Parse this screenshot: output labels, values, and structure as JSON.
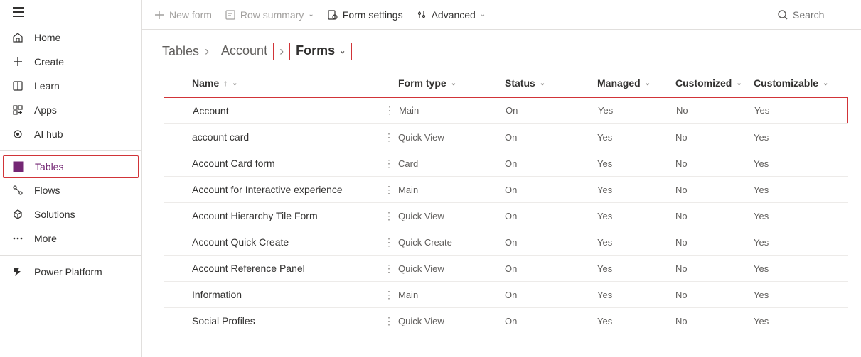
{
  "sidebar": {
    "items": [
      {
        "label": "Home"
      },
      {
        "label": "Create"
      },
      {
        "label": "Learn"
      },
      {
        "label": "Apps"
      },
      {
        "label": "AI hub"
      },
      {
        "label": "Tables"
      },
      {
        "label": "Flows"
      },
      {
        "label": "Solutions"
      },
      {
        "label": "More"
      },
      {
        "label": "Power Platform"
      }
    ]
  },
  "topbar": {
    "new_form": "New form",
    "row_summary": "Row summary",
    "form_settings": "Form settings",
    "advanced": "Advanced",
    "search_placeholder": "Search"
  },
  "breadcrumb": {
    "root": "Tables",
    "mid": "Account",
    "current": "Forms"
  },
  "table": {
    "columns": {
      "name": "Name",
      "form_type": "Form type",
      "status": "Status",
      "managed": "Managed",
      "customized": "Customized",
      "customizable": "Customizable"
    },
    "rows": [
      {
        "name": "Account",
        "form_type": "Main",
        "status": "On",
        "managed": "Yes",
        "customized": "No",
        "customizable": "Yes"
      },
      {
        "name": "account card",
        "form_type": "Quick View",
        "status": "On",
        "managed": "Yes",
        "customized": "No",
        "customizable": "Yes"
      },
      {
        "name": "Account Card form",
        "form_type": "Card",
        "status": "On",
        "managed": "Yes",
        "customized": "No",
        "customizable": "Yes"
      },
      {
        "name": "Account for Interactive experience",
        "form_type": "Main",
        "status": "On",
        "managed": "Yes",
        "customized": "No",
        "customizable": "Yes"
      },
      {
        "name": "Account Hierarchy Tile Form",
        "form_type": "Quick View",
        "status": "On",
        "managed": "Yes",
        "customized": "No",
        "customizable": "Yes"
      },
      {
        "name": "Account Quick Create",
        "form_type": "Quick Create",
        "status": "On",
        "managed": "Yes",
        "customized": "No",
        "customizable": "Yes"
      },
      {
        "name": "Account Reference Panel",
        "form_type": "Quick View",
        "status": "On",
        "managed": "Yes",
        "customized": "No",
        "customizable": "Yes"
      },
      {
        "name": "Information",
        "form_type": "Main",
        "status": "On",
        "managed": "Yes",
        "customized": "No",
        "customizable": "Yes"
      },
      {
        "name": "Social Profiles",
        "form_type": "Quick View",
        "status": "On",
        "managed": "Yes",
        "customized": "No",
        "customizable": "Yes"
      }
    ]
  }
}
